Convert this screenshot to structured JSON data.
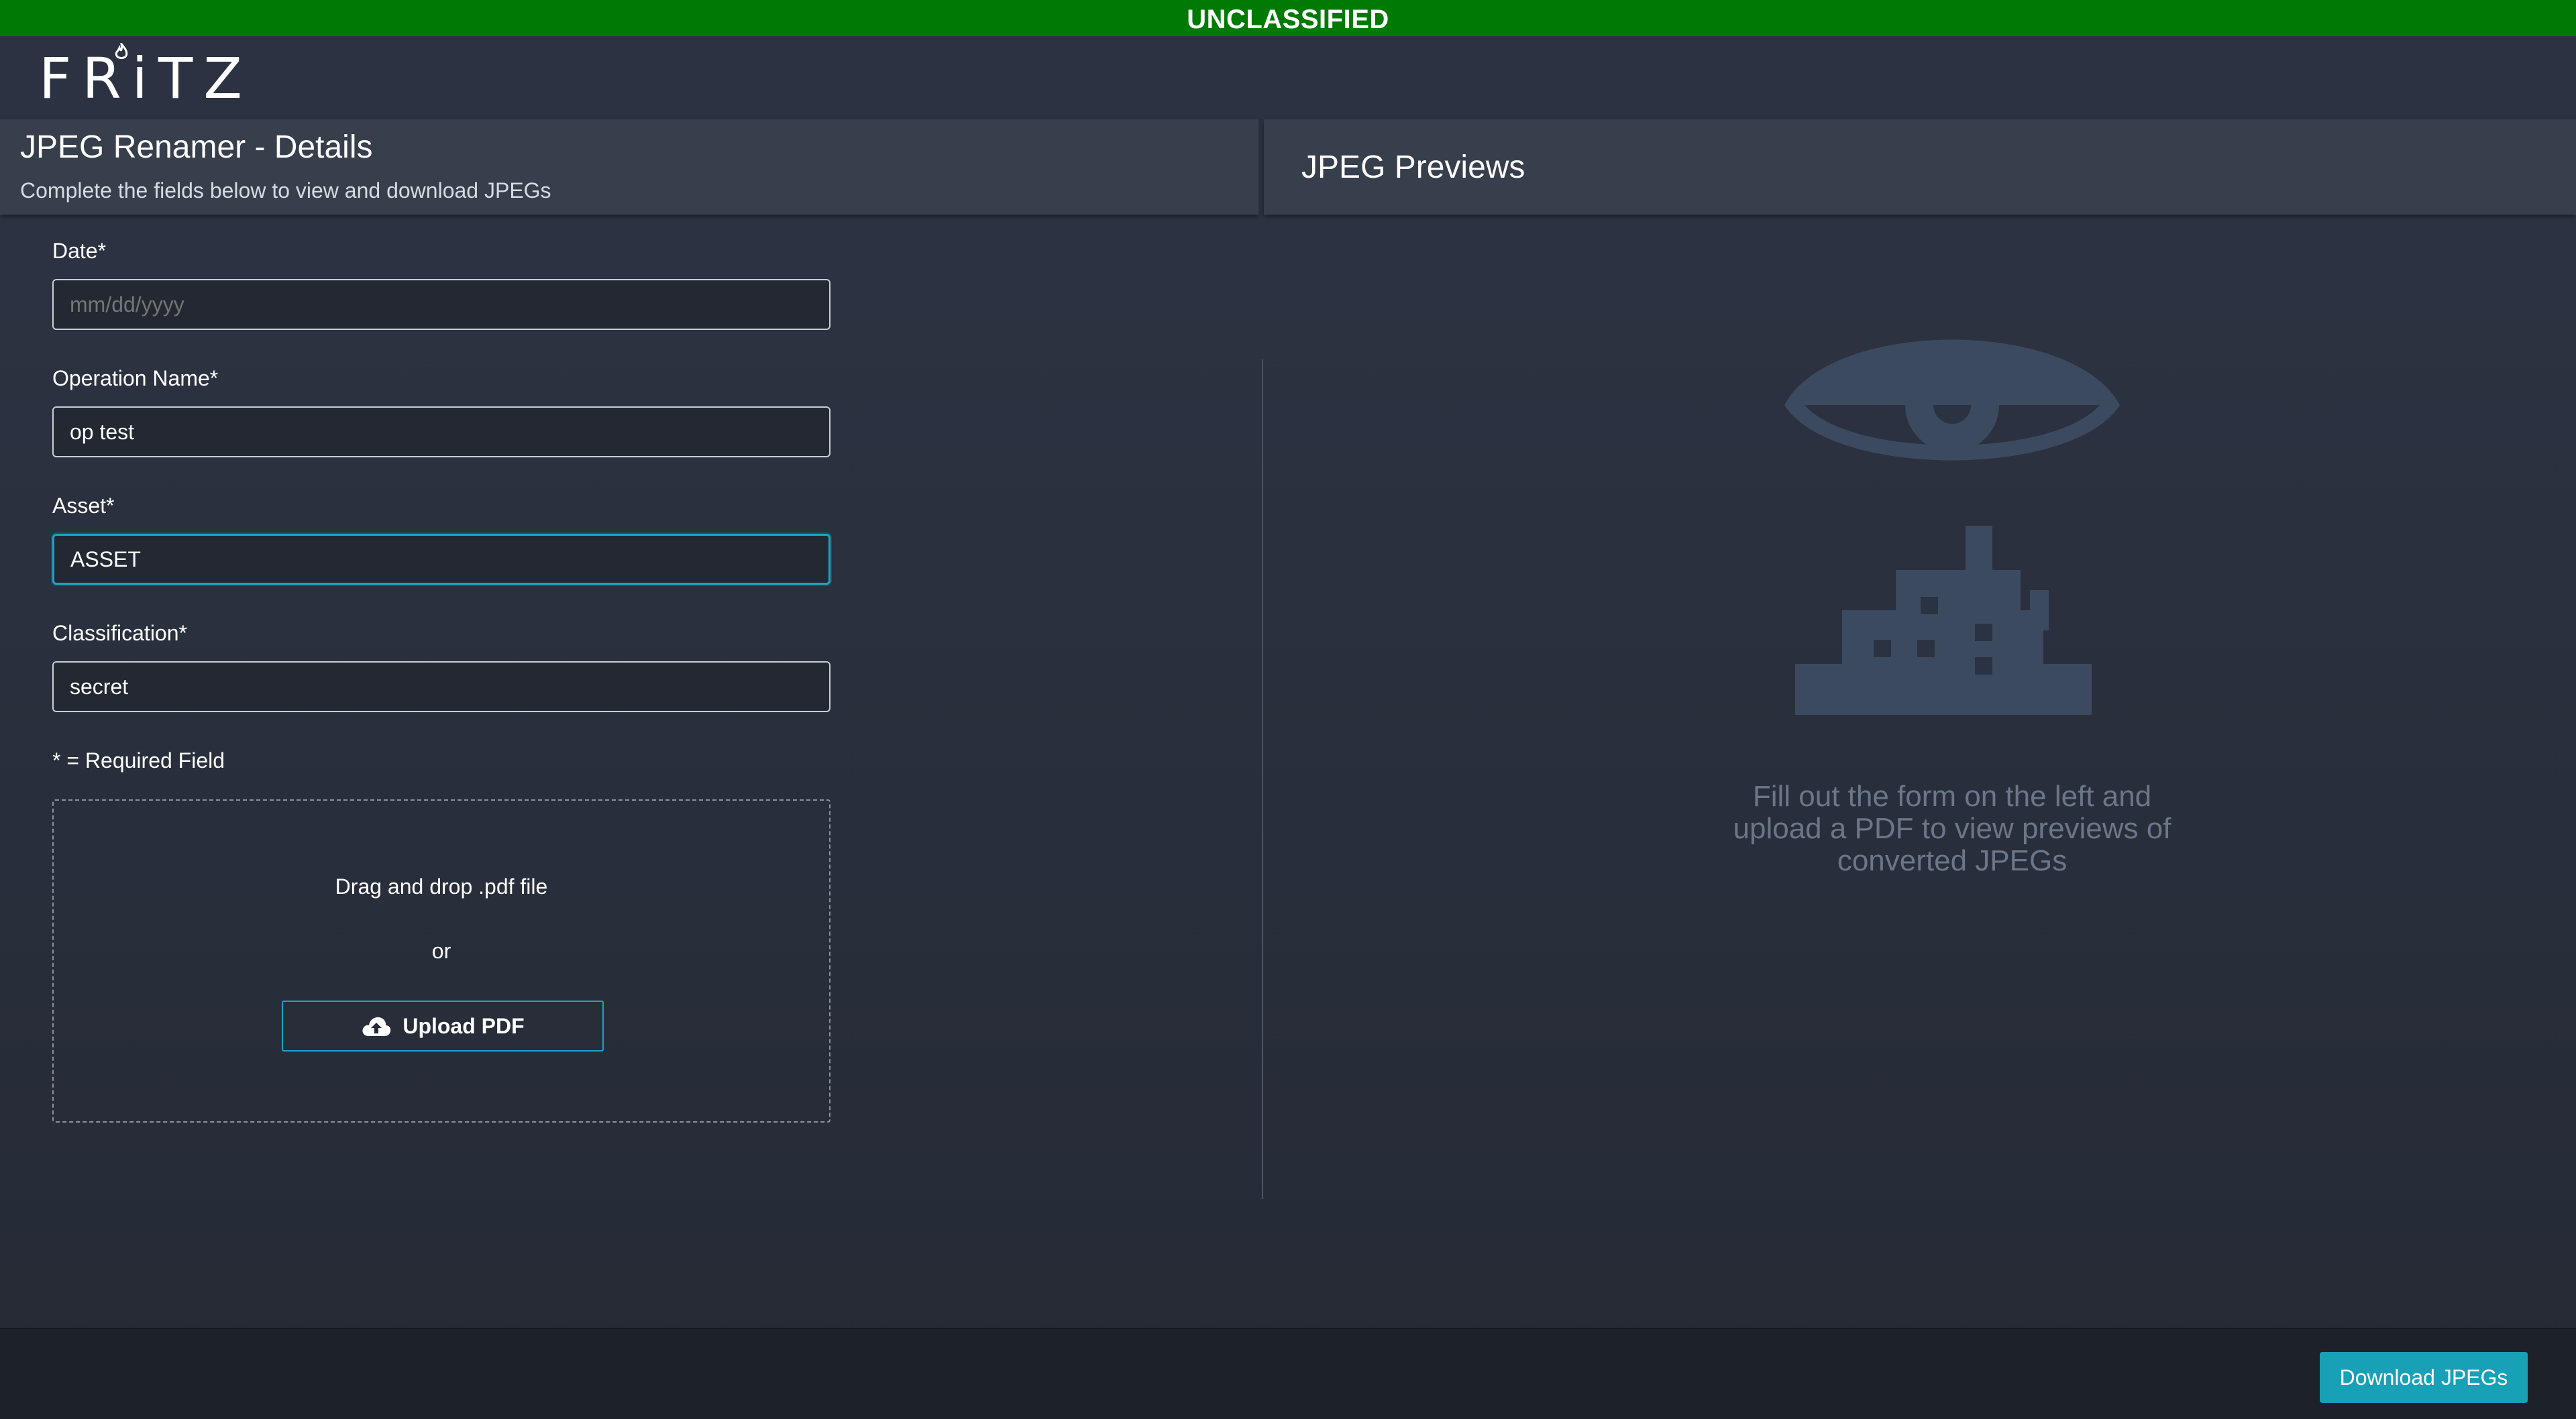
{
  "banner": {
    "classification": "UNCLASSIFIED"
  },
  "header": {
    "logo_text": "FRiTZ"
  },
  "form_panel": {
    "title": "JPEG Renamer - Details",
    "subtitle": "Complete the fields below to view and download JPEGs",
    "fields": [
      {
        "label": "Date*",
        "value": "",
        "placeholder": "mm/dd/yyyy"
      },
      {
        "label": "Operation Name*",
        "value": "op test",
        "placeholder": ""
      },
      {
        "label": "Asset*",
        "value": "ASSET",
        "placeholder": ""
      },
      {
        "label": "Classification*",
        "value": "secret",
        "placeholder": ""
      }
    ],
    "required_note": "* = Required Field",
    "dropzone": {
      "prompt": "Drag and drop .pdf file",
      "separator": "or",
      "upload_label": "Upload PDF",
      "upload_icon": "cloud-upload-icon"
    }
  },
  "preview_panel": {
    "title": "JPEG Previews",
    "placeholder_icon": "eye-over-city-icon",
    "placeholder_message": "Fill out the form on the left and upload a PDF to view previews of converted JPEGs"
  },
  "footer": {
    "download_label": "Download JPEGs"
  },
  "colors": {
    "banner": "#007a05",
    "accent": "#1ba3c9",
    "download_button": "#18a0b7",
    "placeholder_art": "#3c4a60"
  }
}
